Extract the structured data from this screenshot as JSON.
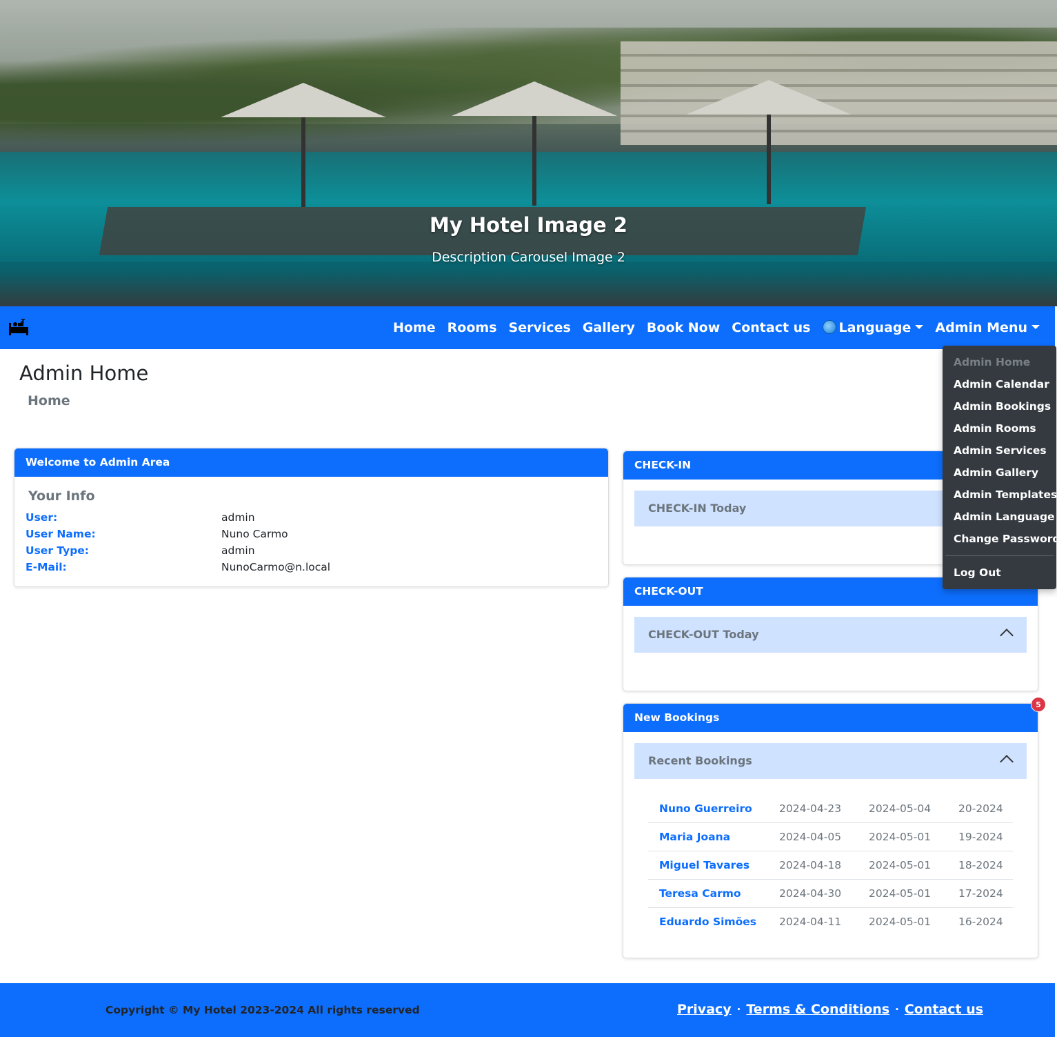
{
  "hero": {
    "title": "My Hotel Image 2",
    "description": "Description Carousel Image 2"
  },
  "navbar": {
    "brand_icon": "hotel-bed-icon",
    "links": [
      "Home",
      "Rooms",
      "Services",
      "Gallery",
      "Book Now",
      "Contact us"
    ],
    "language": {
      "icon": "globe-icon",
      "label": "Language"
    },
    "admin_menu": "Admin Menu"
  },
  "admin_dropdown": {
    "items": [
      "Admin Home",
      "Admin Calendar",
      "Admin Bookings",
      "Admin Rooms",
      "Admin Services",
      "Admin Gallery",
      "Admin Templates",
      "Admin Language",
      "Change Password"
    ],
    "logout": "Log Out"
  },
  "page": {
    "title": "Admin Home",
    "breadcrumb": "Home"
  },
  "welcome_card": {
    "header": "Welcome to Admin Area",
    "section_title": "Your Info",
    "rows": [
      {
        "label": "User:",
        "value": "admin"
      },
      {
        "label": "User Name:",
        "value": "Nuno Carmo"
      },
      {
        "label": "User Type:",
        "value": "admin"
      },
      {
        "label": "E-Mail:",
        "value": "NunoCarmo@n.local"
      }
    ]
  },
  "checkin_card": {
    "header": "CHECK-IN",
    "accordion": "CHECK-IN Today"
  },
  "checkout_card": {
    "header": "CHECK-OUT",
    "accordion": "CHECK-OUT Today"
  },
  "bookings_card": {
    "header": "New Bookings",
    "badge": "5",
    "accordion": "Recent Bookings",
    "rows": [
      {
        "name": "Nuno Guerreiro",
        "checkin": "2024-04-23",
        "checkout": "2024-05-04",
        "ref": "20-2024"
      },
      {
        "name": "Maria Joana",
        "checkin": "2024-04-05",
        "checkout": "2024-05-01",
        "ref": "19-2024"
      },
      {
        "name": "Miguel Tavares",
        "checkin": "2024-04-18",
        "checkout": "2024-05-01",
        "ref": "18-2024"
      },
      {
        "name": "Teresa Carmo",
        "checkin": "2024-04-30",
        "checkout": "2024-05-01",
        "ref": "17-2024"
      },
      {
        "name": "Eduardo Simões",
        "checkin": "2024-04-11",
        "checkout": "2024-05-01",
        "ref": "16-2024"
      }
    ]
  },
  "footer": {
    "copyright": "Copyright © My Hotel 2023-2024 All rights reserved",
    "links": [
      "Privacy",
      "Terms & Conditions",
      "Contact us"
    ]
  },
  "colors": {
    "primary": "#0d6efd",
    "accordion_bg": "#cfe2ff",
    "dropdown_bg": "#343a40",
    "badge": "#dc3545"
  }
}
